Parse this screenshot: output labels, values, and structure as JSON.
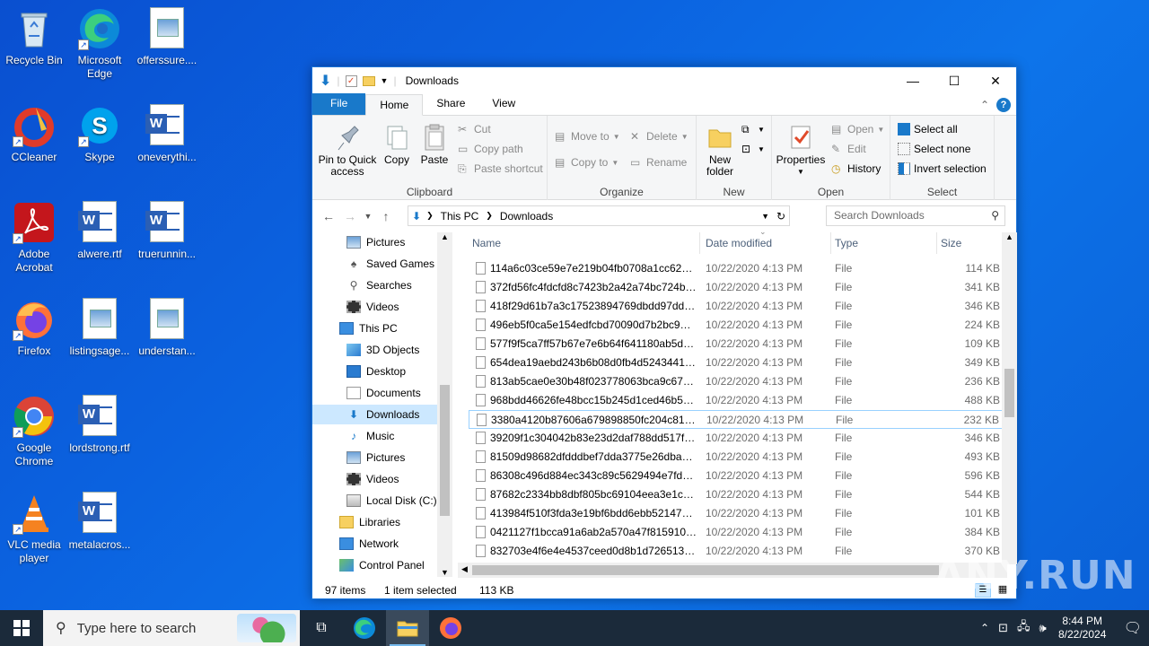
{
  "desktop": {
    "icons": [
      {
        "label": "Recycle Bin"
      },
      {
        "label": "Microsoft Edge"
      },
      {
        "label": "offerssure...."
      },
      {
        "label": "CCleaner"
      },
      {
        "label": "Skype"
      },
      {
        "label": "oneverythi..."
      },
      {
        "label": "Adobe Acrobat"
      },
      {
        "label": "alwere.rtf"
      },
      {
        "label": "truerunnin..."
      },
      {
        "label": "Firefox"
      },
      {
        "label": "listingsage..."
      },
      {
        "label": "understan..."
      },
      {
        "label": "Google Chrome"
      },
      {
        "label": "lordstrong.rtf"
      },
      {
        "label": "VLC media player"
      },
      {
        "label": "metalacros..."
      }
    ]
  },
  "window": {
    "title": "Downloads",
    "tabs": {
      "file": "File",
      "home": "Home",
      "share": "Share",
      "view": "View"
    },
    "help": "?",
    "ribbon": {
      "clipboard": {
        "label": "Clipboard",
        "pin": "Pin to Quick access",
        "copy": "Copy",
        "paste": "Paste",
        "cut": "Cut",
        "copy_path": "Copy path",
        "paste_shortcut": "Paste shortcut"
      },
      "organize": {
        "label": "Organize",
        "move_to": "Move to",
        "copy_to": "Copy to",
        "delete": "Delete",
        "rename": "Rename"
      },
      "new": {
        "label": "New",
        "new_folder": "New folder"
      },
      "open": {
        "label": "Open",
        "properties": "Properties",
        "open": "Open",
        "edit": "Edit",
        "history": "History"
      },
      "select": {
        "label": "Select",
        "select_all": "Select all",
        "select_none": "Select none",
        "invert": "Invert selection"
      }
    },
    "address": {
      "this_pc": "This PC",
      "downloads": "Downloads"
    },
    "search_placeholder": "Search Downloads",
    "nav": [
      {
        "label": "Pictures"
      },
      {
        "label": "Saved Games"
      },
      {
        "label": "Searches"
      },
      {
        "label": "Videos"
      },
      {
        "label": "This PC"
      },
      {
        "label": "3D Objects"
      },
      {
        "label": "Desktop"
      },
      {
        "label": "Documents"
      },
      {
        "label": "Downloads"
      },
      {
        "label": "Music"
      },
      {
        "label": "Pictures"
      },
      {
        "label": "Videos"
      },
      {
        "label": "Local Disk (C:)"
      },
      {
        "label": "Libraries"
      },
      {
        "label": "Network"
      },
      {
        "label": "Control Panel"
      }
    ],
    "columns": {
      "name": "Name",
      "date": "Date modified",
      "type": "Type",
      "size": "Size"
    },
    "files": [
      {
        "name": "114a6c03ce59e7e219b04fb0708a1cc62e06...",
        "date": "10/22/2020 4:13 PM",
        "type": "File",
        "size": "114 KB"
      },
      {
        "name": "372fd56fc4fdcfd8c7423b2a42a74bc724be...",
        "date": "10/22/2020 4:13 PM",
        "type": "File",
        "size": "341 KB"
      },
      {
        "name": "418f29d61b7a3c17523894769dbdd97ddd3...",
        "date": "10/22/2020 4:13 PM",
        "type": "File",
        "size": "346 KB"
      },
      {
        "name": "496eb5f0ca5e154edfcbd70090d7b2bc927...",
        "date": "10/22/2020 4:13 PM",
        "type": "File",
        "size": "224 KB"
      },
      {
        "name": "577f9f5ca7ff57b67e7e6b64f641180ab5db2...",
        "date": "10/22/2020 4:13 PM",
        "type": "File",
        "size": "109 KB"
      },
      {
        "name": "654dea19aebd243b6b08d0fb4d52434412c...",
        "date": "10/22/2020 4:13 PM",
        "type": "File",
        "size": "349 KB"
      },
      {
        "name": "813ab5cae0e30b48f023778063bca9c673d...",
        "date": "10/22/2020 4:13 PM",
        "type": "File",
        "size": "236 KB"
      },
      {
        "name": "968bdd46626fe48bcc15b245d1ced46b5b3...",
        "date": "10/22/2020 4:13 PM",
        "type": "File",
        "size": "488 KB"
      },
      {
        "name": "3380a4120b87606a679898850fc204c81ccc...",
        "date": "10/22/2020 4:13 PM",
        "type": "File",
        "size": "232 KB"
      },
      {
        "name": "39209f1c304042b83e23d2daf788dd517f7f...",
        "date": "10/22/2020 4:13 PM",
        "type": "File",
        "size": "346 KB"
      },
      {
        "name": "81509d98682dfdddbef7dda3775e26dbab6...",
        "date": "10/22/2020 4:13 PM",
        "type": "File",
        "size": "493 KB"
      },
      {
        "name": "86308c496d884ec343c89c5629494e7fd41f...",
        "date": "10/22/2020 4:13 PM",
        "type": "File",
        "size": "596 KB"
      },
      {
        "name": "87682c2334bb8dbf805bc69104eea3e1c50...",
        "date": "10/22/2020 4:13 PM",
        "type": "File",
        "size": "544 KB"
      },
      {
        "name": "413984f510f3fda3e19bf6bdd6ebb5214786...",
        "date": "10/22/2020 4:13 PM",
        "type": "File",
        "size": "101 KB"
      },
      {
        "name": "0421127f1bcca91a6ab2a570a47f8159101b...",
        "date": "10/22/2020 4:13 PM",
        "type": "File",
        "size": "384 KB"
      },
      {
        "name": "832703e4f6e4e4537ceed0d8b1d726513f4c...",
        "date": "10/22/2020 4:13 PM",
        "type": "File",
        "size": "370 KB"
      }
    ],
    "selected_row_index": 8,
    "status": {
      "items": "97 items",
      "selected": "1 item selected",
      "size": "113 KB"
    }
  },
  "taskbar": {
    "search_placeholder": "Type here to search",
    "time": "8:44 PM",
    "date": "8/22/2024"
  },
  "watermark": "ANY.RUN",
  "colors": {
    "accent": "#1979ca",
    "desktop": "#0b63e0",
    "taskbar": "#1b2a3a",
    "selection": "#cce8ff"
  }
}
